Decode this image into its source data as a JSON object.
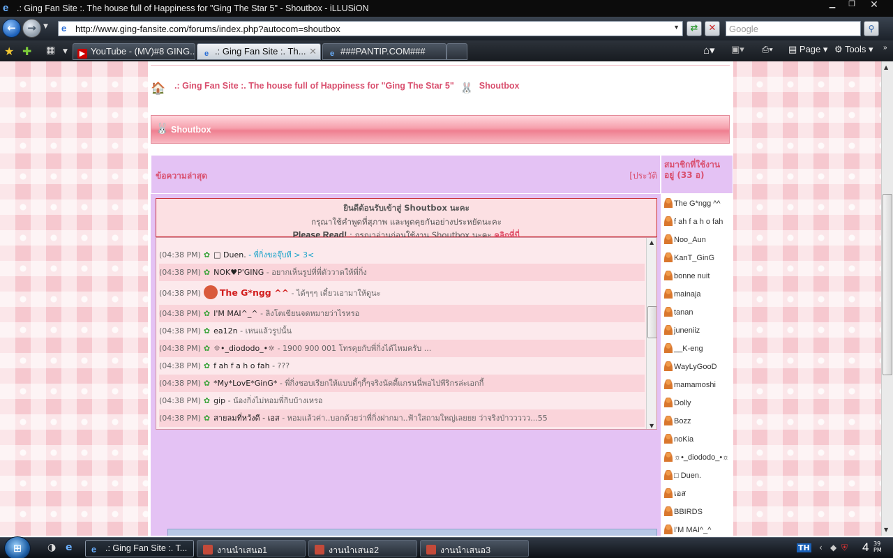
{
  "window": {
    "title": ".: Ging Fan Site :. The house full of Happiness for \"Ging The Star 5\" - Shoutbox - iLLUSiON"
  },
  "navbar": {
    "url": "http://www.ging-fansite.com/forums/index.php?autocom=shoutbox",
    "search_placeholder": "Google"
  },
  "tabs": [
    {
      "label": "YouTube - (MV)#8 GING...",
      "active": false
    },
    {
      "label": ".: Ging Fan Site :. Th...",
      "active": true
    },
    {
      "label": "###PANTIP.COM###",
      "active": false
    }
  ],
  "toolbar": {
    "page_label": "Page",
    "tools_label": "Tools"
  },
  "breadcrumb": {
    "site": ".: Ging Fan Site :. The house full of Happiness for \"Ging The Star 5\"",
    "section": "Shoutbox"
  },
  "banner": {
    "title": "Shoutbox"
  },
  "shoutbox": {
    "header_left": "ข้อความล่าสุด",
    "header_right": "[ประวัติ",
    "welcome_line1": "ยินดีต้อนรับเข้าสู่ Shoutbox นะคะ",
    "welcome_line2": "กรุณาใช้คำพูดที่สุภาพ และพูดคุยกันอย่างประหยัดนะคะ",
    "welcome_read_bold": "Please Read!",
    "welcome_read_text": " : กรุณาอ่านก่อนใช้งาน Shoutbox นะคะ ",
    "welcome_read_link": "คลิกที่นี่",
    "messages": [
      {
        "time": "(04:38 PM)",
        "name": "□ Duen.",
        "msg": " - พี่กิ่งขอจุ๊บที > 3<",
        "blue": true
      },
      {
        "time": "(04:38 PM)",
        "name": "NOK♥P'GING",
        "msg": " - อยากเห็นรูปที่พี่ตัววาดให้พี่กิ่ง"
      },
      {
        "time": "(04:38 PM)",
        "name": "The G*ngg ^^",
        "msg": " - ได้ๆๆๆ เดี๋ยวเอามาให้ดูนะ",
        "big": true
      },
      {
        "time": "(04:38 PM)",
        "name": "I'M MAI^_^",
        "msg": " - ลิงโตเขียนจดหมายว่าไรหรอ"
      },
      {
        "time": "(04:38 PM)",
        "name": "ea12n",
        "msg": " - เหนแล้วรูปนั้น"
      },
      {
        "time": "(04:38 PM)",
        "name": "☼•_diododo_•☼",
        "msg": " - 1900 900 001 โทรคุยกับพี่กิ่งได้ไหมครับ ..."
      },
      {
        "time": "(04:38 PM)",
        "name": "f ah f a h o fah",
        "msg": " - ???"
      },
      {
        "time": "(04:38 PM)",
        "name": "*My*LovE*GinG*",
        "msg": " - พี่กิ่งชอบเรียกให้แบบตี้ๆกี้ๆจริงนัดตี้แกรนนี่พอไปพีริกรล่ะเอกกี้"
      },
      {
        "time": "(04:38 PM)",
        "name": "gip",
        "msg": " - น้องกิ่งไม่หอมพี่กิบบ้างเหรอ"
      },
      {
        "time": "(04:38 PM)",
        "name": "สายลมที่หวังดี - เอส",
        "msg": " - หอมแล้วค่า..บอกด้วยว่าพี่กิ่งฝากมา..ฟ้าใสถามใหญ่เลยยย ว่าจริงป่าววววว...55"
      }
    ]
  },
  "members": {
    "header": "สมาชิกที่ใช้งานอยู่ (33 อ)",
    "list": [
      "The G*ngg ^^",
      "f ah f a h o fah",
      "Noo_Aun",
      "KanT_GinG",
      "bonne nuit",
      "mainaja",
      "tanan",
      "juneniiz",
      "__K-eng",
      "WayLyGooD",
      "mamamoshi",
      "Dolly",
      "Bozz",
      "noKia",
      "☼•_diododo_•☼",
      "□ Duen.",
      "เอส",
      "BBIRDS",
      "I'M MAI^_^"
    ]
  },
  "taskbar": {
    "items": [
      {
        "label": ".: Ging Fan Site :. T...",
        "active": true
      },
      {
        "label": "งานนำเสนอ1",
        "active": false
      },
      {
        "label": "งานนำเสนอ2",
        "active": false
      },
      {
        "label": "งานนำเสนอ3",
        "active": false
      }
    ],
    "lang": "TH",
    "clock": "4",
    "clock_min": "39",
    "clock_ampm": "PM"
  }
}
